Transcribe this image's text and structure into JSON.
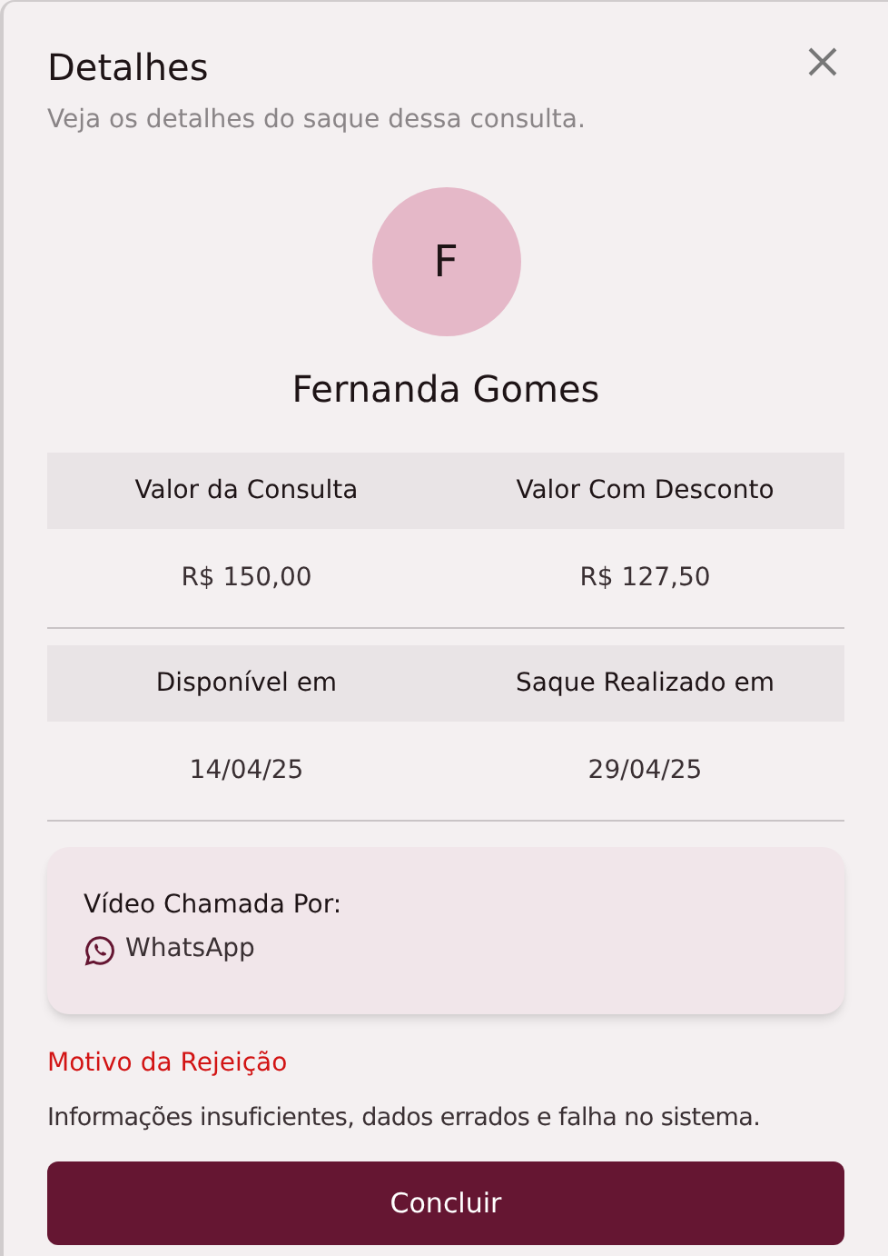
{
  "dialog": {
    "title": "Detalhes",
    "subtitle": "Veja os detalhes do saque dessa consulta."
  },
  "profile": {
    "initial": "F",
    "name": "Fernanda Gomes"
  },
  "tables": [
    {
      "columns": [
        "Valor da Consulta",
        "Valor Com Desconto"
      ],
      "values": [
        "R$ 150,00",
        "R$ 127,50"
      ]
    },
    {
      "columns": [
        "Disponível em",
        "Saque Realizado em"
      ],
      "values": [
        "14/04/25",
        "29/04/25"
      ]
    }
  ],
  "video_call": {
    "label": "Vídeo Chamada Por:",
    "app": "WhatsApp"
  },
  "rejection": {
    "title": "Motivo da Rejeição",
    "reason": "Informações insuficientes, dados errados e falha no sistema."
  },
  "buttons": [
    "Concluir"
  ]
}
